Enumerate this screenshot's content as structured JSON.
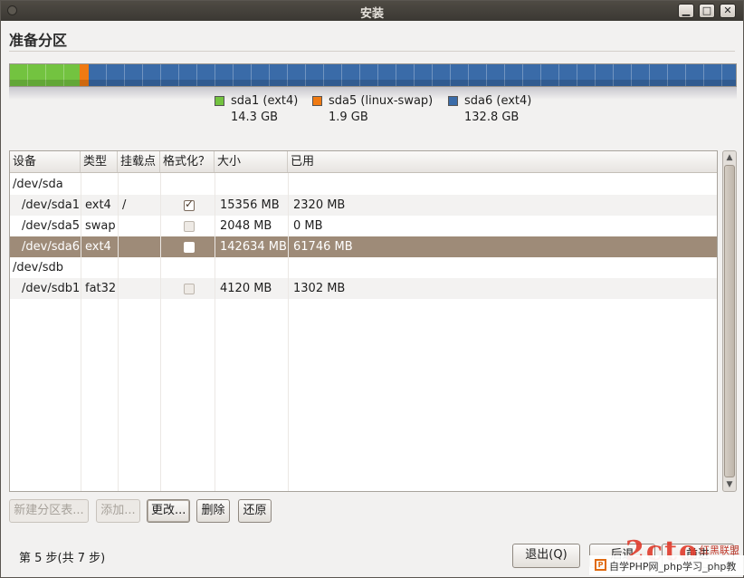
{
  "window": {
    "title": "安装",
    "minimize_glyph": "▁",
    "maximize_glyph": "□",
    "close_glyph": "✕"
  },
  "page_title": "准备分区",
  "partition_bar": {
    "segments": [
      {
        "name": "sda1 (ext4)",
        "size": "14.3 GB",
        "size_gb": 14.3,
        "color": "#73c340"
      },
      {
        "name": "sda5 (linux-swap)",
        "size": "1.9 GB",
        "size_gb": 1.9,
        "color": "#f07a12"
      },
      {
        "name": "sda6 (ext4)",
        "size": "132.8 GB",
        "size_gb": 132.8,
        "color": "#3a6ba8"
      }
    ]
  },
  "table": {
    "columns": [
      "设备",
      "类型",
      "挂载点",
      "格式化？",
      "大小",
      "已用"
    ],
    "rows": [
      {
        "device": "/dev/sda",
        "type": "",
        "mount": "",
        "format": null,
        "size": "",
        "used": "",
        "indent": false,
        "selected": false
      },
      {
        "device": "/dev/sda1",
        "type": "ext4",
        "mount": "/",
        "format": true,
        "size": "15356 MB",
        "used": "2320 MB",
        "indent": true,
        "selected": false
      },
      {
        "device": "/dev/sda5",
        "type": "swap",
        "mount": "",
        "format": false,
        "size": "2048 MB",
        "used": "0 MB",
        "indent": true,
        "selected": false
      },
      {
        "device": "/dev/sda6",
        "type": "ext4",
        "mount": "",
        "format": false,
        "size": "142634 MB",
        "used": "61746 MB",
        "indent": true,
        "selected": true
      },
      {
        "device": "/dev/sdb",
        "type": "",
        "mount": "",
        "format": null,
        "size": "",
        "used": "",
        "indent": false,
        "selected": false
      },
      {
        "device": "/dev/sdb1",
        "type": "fat32",
        "mount": "",
        "format": false,
        "size": "4120 MB",
        "used": "1302 MB",
        "indent": true,
        "selected": false
      }
    ]
  },
  "actions": {
    "new_table": "新建分区表...",
    "add": "添加...",
    "change": "更改...",
    "delete": "删除",
    "revert": "还原"
  },
  "footer": {
    "step": "第 5 步(共 7 步)",
    "quit": "退出(Q)",
    "back": "后退",
    "forward": "前进"
  },
  "watermark": {
    "icon": "P",
    "text": "自学PHP网_php学习_php教",
    "logo": "2cto",
    "red_text": "红黑联盟"
  }
}
